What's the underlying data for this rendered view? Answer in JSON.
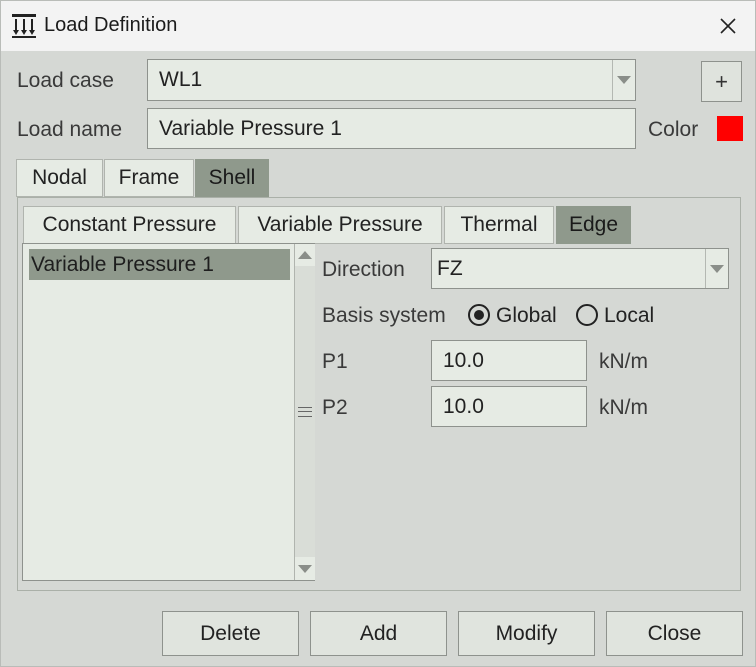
{
  "window": {
    "title": "Load Definition"
  },
  "form": {
    "load_case_label": "Load case",
    "load_case_value": "WL1",
    "add_button_label": "+",
    "load_name_label": "Load name",
    "load_name_value": "Variable Pressure 1",
    "color_label": "Color",
    "color_value": "#ff0000"
  },
  "element_tabs": [
    "Nodal",
    "Frame",
    "Shell"
  ],
  "element_tabs_active": "Shell",
  "load_type_tabs": [
    "Constant Pressure",
    "Variable Pressure",
    "Thermal",
    "Edge"
  ],
  "load_type_tabs_active": "Edge",
  "load_list": {
    "items": [
      "Variable Pressure 1"
    ],
    "selected": "Variable Pressure 1"
  },
  "edge": {
    "direction_label": "Direction",
    "direction_value": "FZ",
    "basis_label": "Basis system",
    "basis_options": [
      "Global",
      "Local"
    ],
    "basis_selected": "Global",
    "p1_label": "P1",
    "p1_value": "10.0",
    "p1_unit": "kN/m",
    "p2_label": "P2",
    "p2_value": "10.0",
    "p2_unit": "kN/m"
  },
  "buttons": {
    "delete": "Delete",
    "add": "Add",
    "modify": "Modify",
    "close": "Close"
  }
}
